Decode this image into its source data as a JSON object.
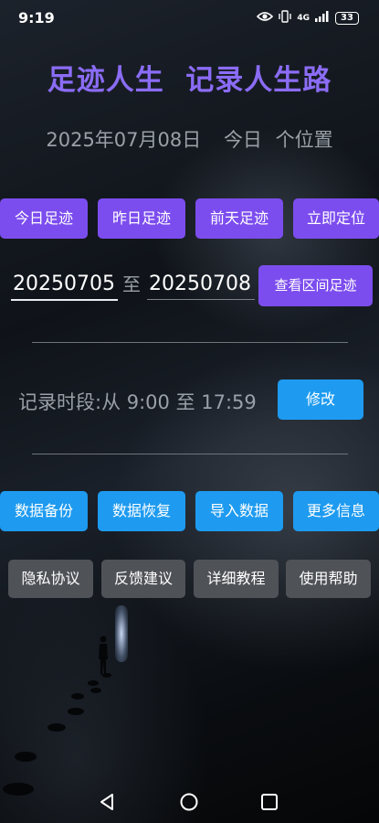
{
  "status_bar": {
    "time": "9:19",
    "network": "4G",
    "battery": "33",
    "icons": [
      "eye-icon",
      "vibrate-icon",
      "signal-icon",
      "battery-icon"
    ]
  },
  "header": {
    "title": "足迹人生  记录人生路",
    "date": "2025年07月08日",
    "day_label": "今日",
    "position_count": "个位置"
  },
  "quick_buttons": [
    "今日足迹",
    "昨日足迹",
    "前天足迹",
    "立即定位"
  ],
  "range": {
    "start_date": "20250705",
    "to_label": "至",
    "end_date": "20250708",
    "query_button": "查看区间足迹"
  },
  "record_period": {
    "text": "记录时段:从 9:00 至 17:59",
    "edit_button": "修改"
  },
  "data_buttons": [
    "数据备份",
    "数据恢复",
    "导入数据",
    "更多信息"
  ],
  "help_buttons": [
    "隐私协议",
    "反馈建议",
    "详细教程",
    "使用帮助"
  ],
  "colors": {
    "title": "#8b6cf6",
    "purple_button": "#7c4dee",
    "blue_button": "#1e9bf0",
    "gray_button": "#4f5257",
    "muted_text": "#9aa0a8"
  },
  "nav_bar": {
    "icons": [
      "back-icon",
      "home-icon",
      "recents-icon"
    ]
  }
}
